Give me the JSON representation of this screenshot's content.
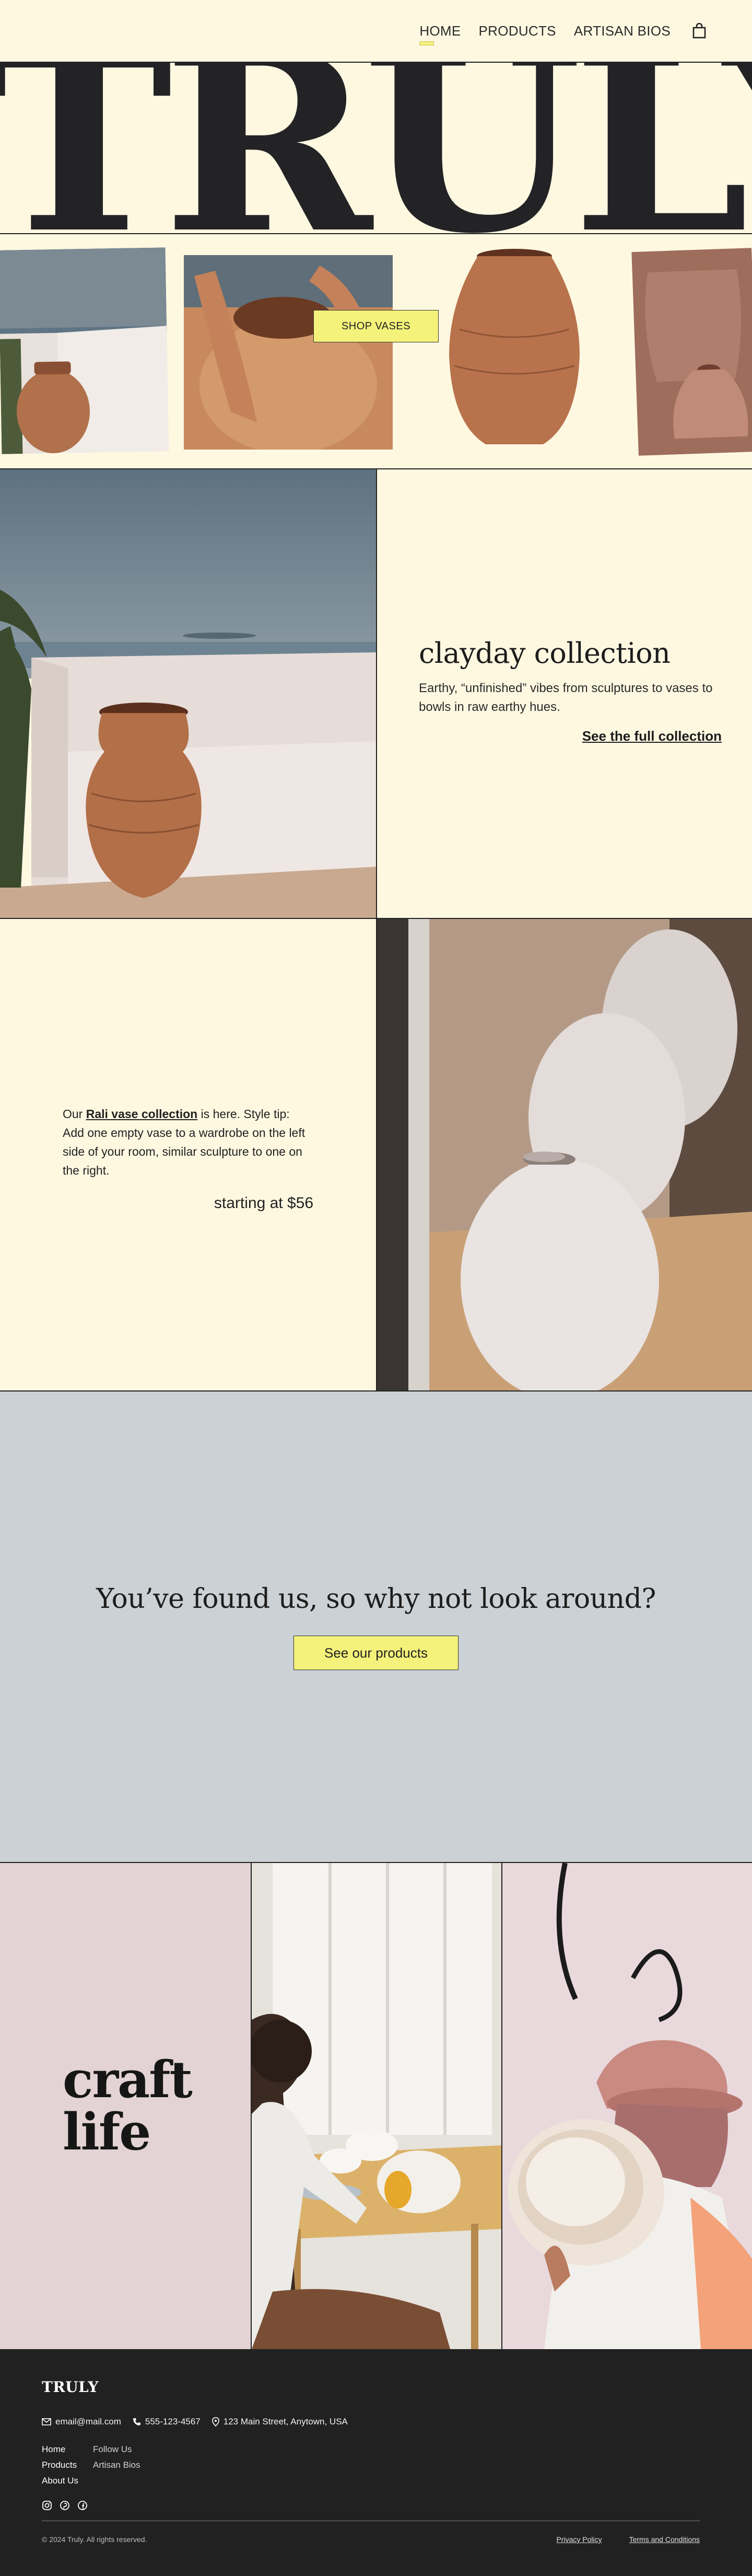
{
  "nav": {
    "items": [
      "HOME",
      "PRODUCTS",
      "ARTISAN BIOS"
    ],
    "active": "HOME",
    "cart_icon": "shopping-bag-icon"
  },
  "hero": {
    "title": "TRULY",
    "shop_button": "SHOP VASES"
  },
  "clayday": {
    "heading": "clayday collection",
    "body": "Earthy, “unfinished” vibes from sculptures to vases to bowls in raw earthy hues.",
    "link": "See the full collection"
  },
  "rali": {
    "intro": "Our",
    "link": "Rali vase collection",
    "body": " is here. Style tip: Add one empty vase to a wardrobe on the left side of your room, similar sculpture to one on the right.",
    "price": "starting at $56"
  },
  "cta": {
    "heading": "You’ve found us, so why not look around?",
    "button": "See our products"
  },
  "craft": {
    "heading_line1": "craft",
    "heading_line2": "life"
  },
  "footer": {
    "logo": "TRULY",
    "email": "email@mail.com",
    "phone": "555-123-4567",
    "address": "123 Main Street, Anytown, USA",
    "col1": [
      "Home",
      "Products",
      "About Us"
    ],
    "col2": [
      "Follow Us",
      "Artisan Bios"
    ],
    "social_icons": [
      "instagram-icon",
      "pinterest-icon",
      "facebook-icon"
    ],
    "copyright": "© 2024 Truly. All rights reserved.",
    "privacy": "Privacy Policy",
    "terms": "Terms and Conditions"
  },
  "colors": {
    "cream": "#fff8e1",
    "yellow": "#f4f27a",
    "slate": "#cbd1d4",
    "blush": "#e3d3d4",
    "ink": "#212121"
  }
}
